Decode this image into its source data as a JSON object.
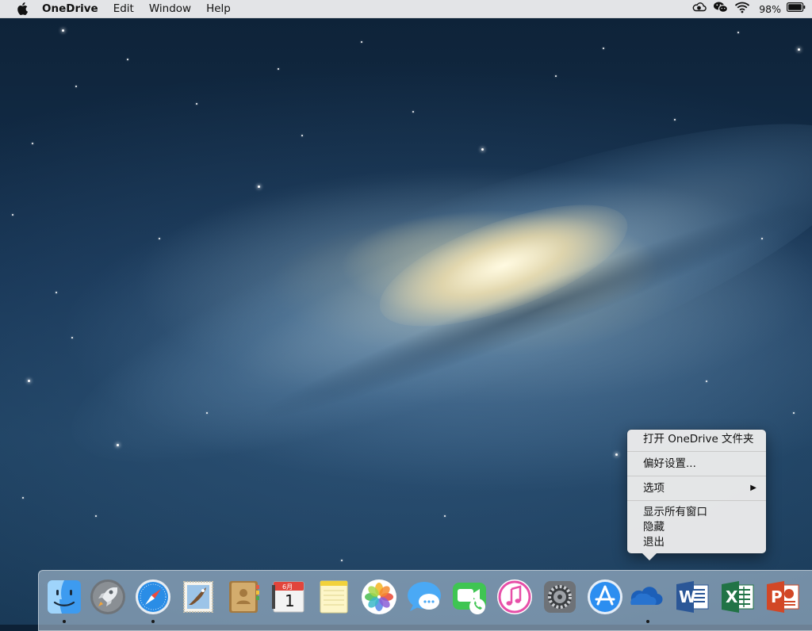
{
  "menubar": {
    "apple_icon": "apple-logo-icon",
    "app_name": "OneDrive",
    "menus": [
      "Edit",
      "Window",
      "Help"
    ],
    "status_icons": [
      "onedrive-sync-icon",
      "wechat-icon",
      "wifi-icon",
      "battery-icon"
    ],
    "battery_percent": "98%"
  },
  "context_menu": {
    "open_folder": "打开 OneDrive 文件夹",
    "preferences": "偏好设置...",
    "options": "选项",
    "options_arrow": "▶",
    "show_all_windows": "显示所有窗口",
    "hide": "隐藏",
    "quit": "退出"
  },
  "dock": {
    "apps": [
      {
        "name": "Finder",
        "icon": "finder-icon",
        "running": true
      },
      {
        "name": "Launchpad",
        "icon": "launchpad-rocket-icon",
        "running": false
      },
      {
        "name": "Safari",
        "icon": "safari-compass-icon",
        "running": true
      },
      {
        "name": "Mail",
        "icon": "mail-stamp-icon",
        "running": false
      },
      {
        "name": "Contacts",
        "icon": "contacts-book-icon",
        "running": false
      },
      {
        "name": "Calendar",
        "icon": "calendar-icon",
        "running": false
      },
      {
        "name": "Notes",
        "icon": "notes-icon",
        "running": false
      },
      {
        "name": "Photos",
        "icon": "photos-flower-icon",
        "running": false
      },
      {
        "name": "Messages",
        "icon": "messages-bubble-icon",
        "running": false
      },
      {
        "name": "FaceTime",
        "icon": "facetime-camera-icon",
        "running": false
      },
      {
        "name": "iTunes",
        "icon": "itunes-note-icon",
        "running": false
      },
      {
        "name": "System Preferences",
        "icon": "system-preferences-gear-icon",
        "running": false
      },
      {
        "name": "App Store",
        "icon": "app-store-icon",
        "running": false
      },
      {
        "name": "OneDrive",
        "icon": "onedrive-cloud-icon",
        "running": true
      },
      {
        "name": "Word",
        "icon": "word-icon",
        "running": false
      },
      {
        "name": "Excel",
        "icon": "excel-icon",
        "running": false
      },
      {
        "name": "PowerPoint",
        "icon": "powerpoint-icon",
        "running": false
      }
    ],
    "calendar_month": "6月",
    "calendar_day": "1",
    "word_letter": "W",
    "excel_letter": "X",
    "powerpoint_letter": "P"
  },
  "colors": {
    "menubar_bg": "#ececee",
    "menu_bg": "#ececec",
    "onedrive_blue": "#1c5fb8",
    "word_blue": "#2b5797",
    "excel_green": "#217346",
    "powerpoint_red": "#d24726"
  }
}
